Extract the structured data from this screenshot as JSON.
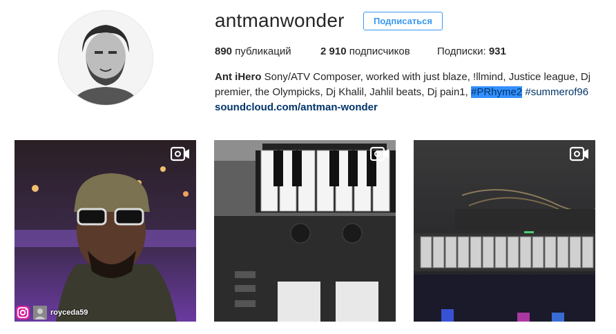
{
  "profile": {
    "username": "antmanwonder",
    "follow_label": "Подписаться",
    "stats": {
      "posts_count": "890",
      "posts_label": "публикаций",
      "followers_count": "2 910",
      "followers_label": "подписчиков",
      "following_label": "Подписки:",
      "following_count": "931"
    },
    "bio": {
      "name": "Ant iHero",
      "text": "Sony/ATV Composer, worked with just blaze, !llmind, Justice league, Dj premier, the Olympicks, Dj Khalil, Jahlil beats, Dj pain1,",
      "hashtag1": "#PRhyme2",
      "hashtag2": "#summerof96",
      "link": "soundcloud.com/antman-wonder"
    }
  },
  "posts": [
    {
      "type": "video",
      "icon": "video-camera-icon",
      "tagged_user": "royceda59"
    },
    {
      "type": "video",
      "icon": "video-camera-icon"
    },
    {
      "type": "video",
      "icon": "video-camera-icon"
    }
  ],
  "colors": {
    "accent": "#3897f0",
    "link": "#003569",
    "selection": "#3390ff",
    "text": "#262626"
  }
}
